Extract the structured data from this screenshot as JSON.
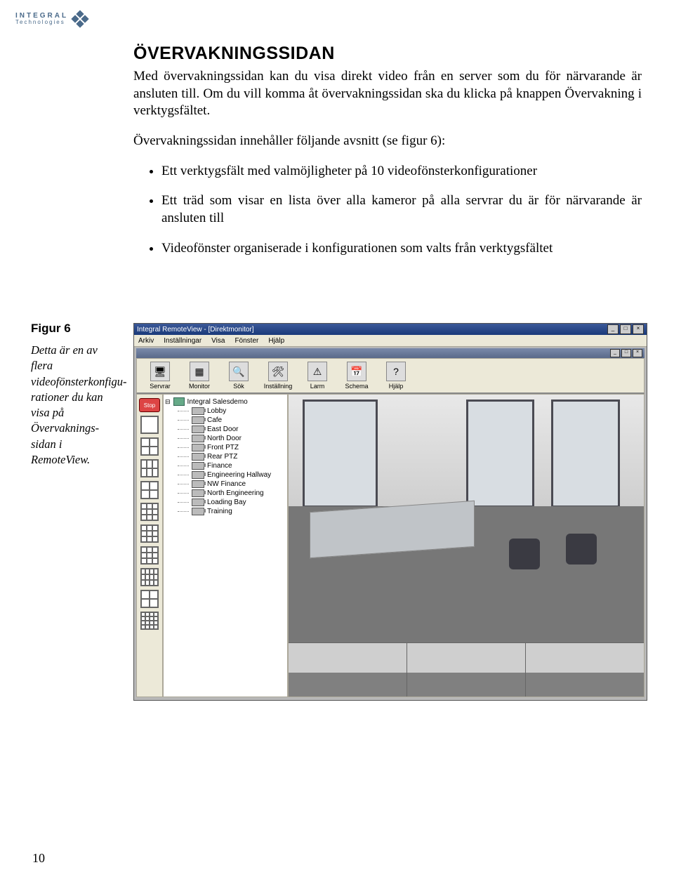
{
  "logo": {
    "line1": "INTEGRAL",
    "line2": "Technologies"
  },
  "heading": "ÖVERVAKNINGSSIDAN",
  "para1": "Med övervakningssidan kan du visa direkt video från en server som du för närvarande är ansluten till. Om du vill komma åt övervakningssidan ska du klicka på knappen Övervakning i verktygsfältet.",
  "para2": "Övervakningssidan innehåller följande avsnitt (se figur 6):",
  "bullets": {
    "b1": "Ett verktygsfält med valmöjligheter på 10 videofönsterkonfigurationer",
    "b2": "Ett träd som visar en lista över alla kameror på alla servrar du är för närvarande är ansluten till",
    "b3": "Videofönster organiserade i konfigurationen som valts från verktygsfältet"
  },
  "figure": {
    "label": "Figur 6",
    "caption": "Detta är en av flera videofönsterkonfigu-rationer du kan visa på Övervaknings-sidan i RemoteView."
  },
  "screenshot": {
    "title": "Integral RemoteView - [Direktmonitor]",
    "menu": {
      "m1": "Arkiv",
      "m2": "Inställningar",
      "m3": "Visa",
      "m4": "Fönster",
      "m5": "Hjälp"
    },
    "toolbar": {
      "t1": "Servrar",
      "t2": "Monitor",
      "t3": "Sök",
      "t4": "Inställning",
      "t5": "Larm",
      "t6": "Schema",
      "t7": "Hjälp"
    },
    "toolbar_icons": {
      "t1": "🖥",
      "t2": "▦",
      "t3": "🔍",
      "t4": "🛠",
      "t5": "⚠",
      "t6": "📅",
      "t7": "?"
    },
    "stop": "Stop",
    "tree": {
      "root": "Integral Salesdemo",
      "items": [
        "Lobby",
        "Cafe",
        "East Door",
        "North Door",
        "Front PTZ",
        "Rear PTZ",
        "Finance",
        "Engineering Hallway",
        "NW Finance",
        "North Engineering",
        "Loading Bay",
        "Training"
      ]
    }
  },
  "pagenum": "10"
}
